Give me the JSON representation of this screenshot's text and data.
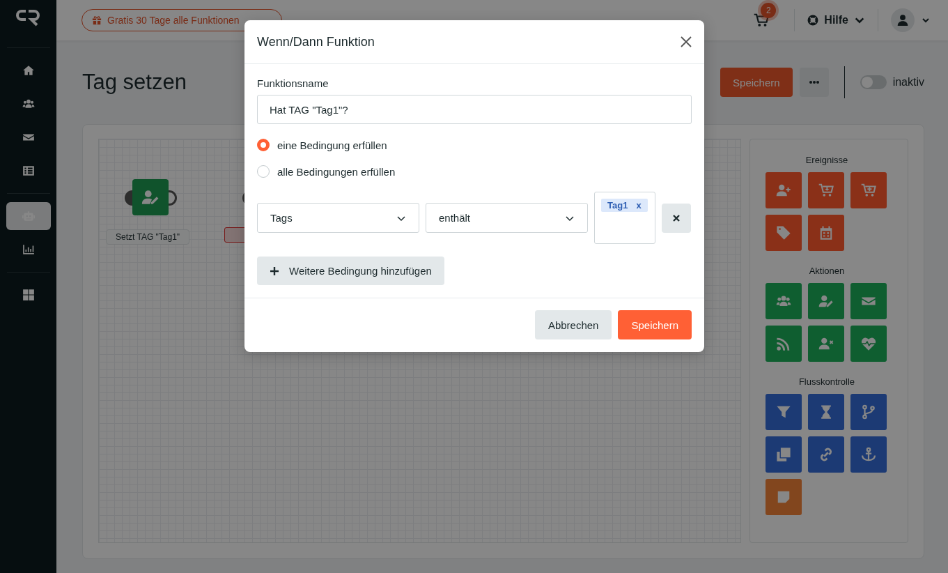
{
  "sidebar": {
    "items": [
      {
        "kind": "home",
        "selected": false
      },
      {
        "kind": "group",
        "selected": false
      },
      {
        "kind": "mail",
        "selected": false
      },
      {
        "kind": "list",
        "selected": false
      },
      {
        "kind": "robot",
        "selected": true
      },
      {
        "kind": "chart",
        "selected": false
      },
      {
        "kind": "grid",
        "selected": false
      }
    ]
  },
  "header": {
    "promo": "Gratis 30 Tage alle Funktionen",
    "cart_badge": "2",
    "help": "Hilfe"
  },
  "page": {
    "title": "Tag setzen",
    "save": "Speichern",
    "toggle": {
      "on": false,
      "label": "inaktiv"
    }
  },
  "canvas": {
    "node": {
      "label": "Setzt TAG \"Tag1\""
    }
  },
  "palette": [
    {
      "title": "Ereignisse",
      "tiles": [
        {
          "kind": "adduser",
          "color": "#8a3018"
        },
        {
          "kind": "cartdown",
          "color": "#8a3018"
        },
        {
          "kind": "cartplus",
          "color": "#8a3018"
        },
        {
          "kind": "tag",
          "color": "#8a3018"
        },
        {
          "kind": "calendar",
          "color": "#8a3018"
        }
      ]
    },
    {
      "title": "Aktionen",
      "tiles": [
        {
          "kind": "group",
          "color": "#0f5e30"
        },
        {
          "kind": "useredit",
          "color": "#0f5e30"
        },
        {
          "kind": "mail",
          "color": "#0f5e30"
        },
        {
          "kind": "feed",
          "color": "#0f5e30"
        },
        {
          "kind": "userremove",
          "color": "#0f5e30"
        },
        {
          "kind": "heart",
          "color": "#0f5e30"
        }
      ]
    },
    {
      "title": "Flusskontrolle",
      "tiles": [
        {
          "kind": "filter",
          "color": "#1c3a74"
        },
        {
          "kind": "hourglass",
          "color": "#1c3a74"
        },
        {
          "kind": "branch",
          "color": "#1c3a74"
        },
        {
          "kind": "copy",
          "color": "#1c3a74"
        },
        {
          "kind": "link",
          "color": "#1c3a74"
        },
        {
          "kind": "anchor",
          "color": "#1c3a74"
        },
        {
          "kind": "note",
          "color": "#82461e"
        }
      ]
    }
  ],
  "dialog": {
    "title": "Wenn/Dann Funktion",
    "name_label": "Funktionsname",
    "name_value": "Hat TAG \"Tag1\"?",
    "options": [
      {
        "label": "eine Bedingung erfüllen",
        "selected": true
      },
      {
        "label": "alle Bedingungen erfüllen",
        "selected": false
      }
    ],
    "condition": {
      "field": "Tags",
      "operator": "enthält",
      "tags": [
        "Tag1"
      ],
      "tag_remove": "x"
    },
    "add": "Weitere Bedingung hinzufügen",
    "cancel": "Abbrechen",
    "save": "Speichern"
  }
}
